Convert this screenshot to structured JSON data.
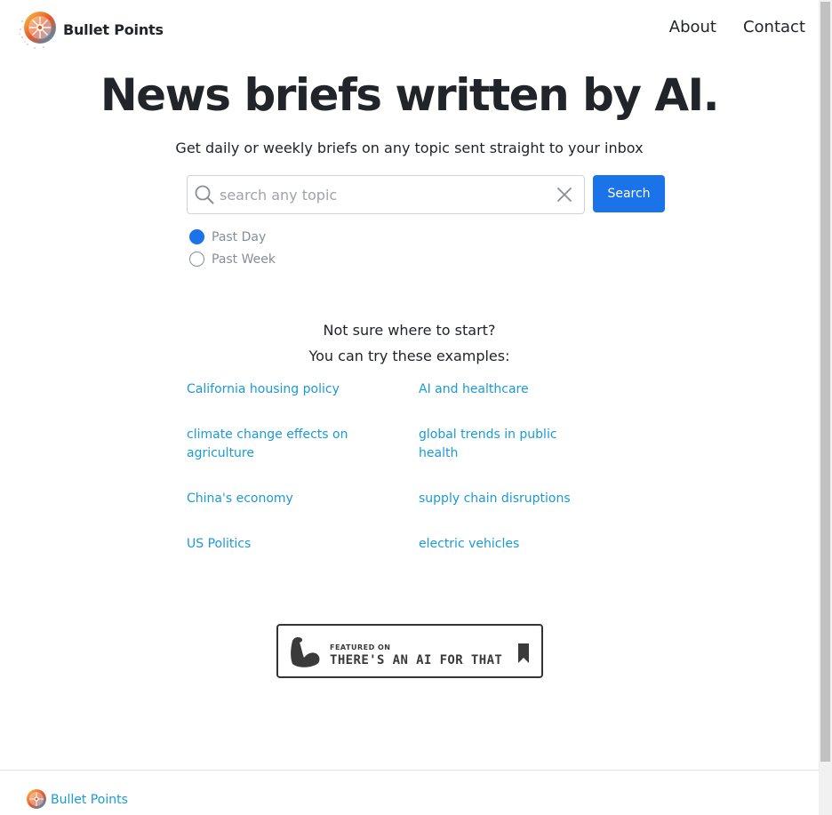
{
  "brand": {
    "name": "Bullet Points"
  },
  "nav": {
    "about": "About",
    "contact": "Contact"
  },
  "hero": {
    "title": "News briefs written by AI.",
    "subtitle": "Get daily or weekly briefs on any topic sent straight to your inbox"
  },
  "search": {
    "placeholder": "search any topic",
    "value": "",
    "button_label": "Search"
  },
  "range": {
    "options": [
      {
        "label": "Past Day",
        "checked": true
      },
      {
        "label": "Past Week",
        "checked": false
      }
    ]
  },
  "examples": {
    "heading_1": "Not sure where to start?",
    "heading_2": "You can try these examples:",
    "items": [
      "California housing policy",
      "AI and healthcare",
      "climate change effects on agriculture",
      "global trends in public health",
      "China's economy",
      "supply chain disruptions",
      "US Politics",
      "electric vehicles"
    ]
  },
  "badge": {
    "small_text": "FEATURED ON",
    "large_text": "THERE'S AN AI FOR THAT"
  },
  "footer": {
    "brand": "Bullet Points"
  },
  "colors": {
    "accent": "#1a73e8",
    "link": "#1a9ad6",
    "text": "#212529",
    "muted": "#868e96"
  },
  "icons": [
    "brand-logo-icon",
    "search-icon",
    "close-icon",
    "flexed-arm-icon",
    "bookmark-icon"
  ]
}
